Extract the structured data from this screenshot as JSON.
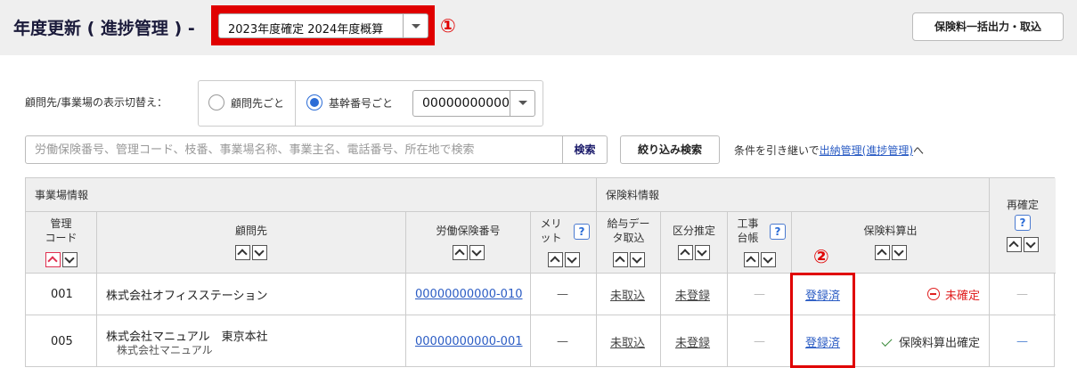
{
  "header": {
    "title": "年度更新 ( 進捗管理 ) -",
    "year_select": "2023年度確定 2024年度概算",
    "marker_1": "①",
    "bulk_button": "保険料一括出力・取込"
  },
  "toggle": {
    "label": "顧問先/事業場の表示切替え：",
    "option_client": "顧問先ごと",
    "option_base": "基幹番号ごと",
    "selected": "基幹番号ごと",
    "code_value": "00000000000"
  },
  "search": {
    "placeholder": "労働保険番号、管理コード、枝番、事業場名称、事業主名、電話番号、所在地で検索",
    "search_button": "検索",
    "filter_button": "絞り込み検索",
    "carry_prefix": "条件を引き継いで",
    "carry_link": "出納管理(進捗管理)",
    "carry_suffix": "へ"
  },
  "table": {
    "group_office": "事業場情報",
    "group_premium": "保険料情報",
    "col_reconfirm": "再確定",
    "col_code_1": "管理",
    "col_code_2": "コード",
    "col_client": "顧問先",
    "col_insno": "労働保険番号",
    "col_merit_1": "メリ",
    "col_merit_2": "ット",
    "col_salary_1": "給与デー",
    "col_salary_2": "タ取込",
    "col_division": "区分推定",
    "col_ledger_1": "工事",
    "col_ledger_2": "台帳",
    "col_calc": "保険料算出",
    "help": "?",
    "marker_2": "②",
    "rows": [
      {
        "code": "001",
        "client": "株式会社オフィスステーション",
        "client_sub": "",
        "insno": "00000000000-010",
        "merit": "—",
        "salary": "未取込",
        "division": "未登録",
        "ledger": "—",
        "calc_link": "登録済",
        "calc_status": "未確定",
        "reconfirm": "—"
      },
      {
        "code": "005",
        "client": "株式会社マニュアル　東京本社",
        "client_sub": "株式会社マニュアル",
        "insno": "00000000000-001",
        "merit": "—",
        "salary": "未取込",
        "division": "未登録",
        "ledger": "—",
        "calc_link": "登録済",
        "calc_status": "保険料算出確定",
        "reconfirm": "—"
      }
    ]
  }
}
